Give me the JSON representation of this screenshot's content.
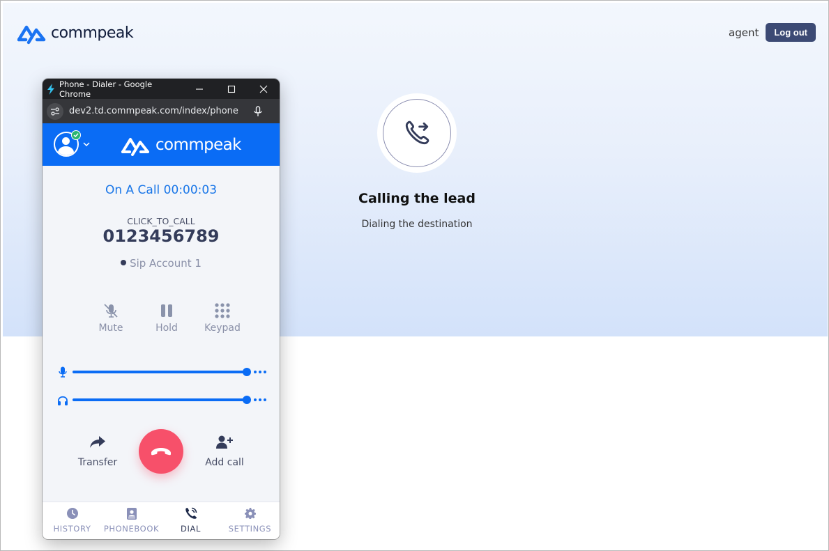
{
  "site": {
    "logo_text": "commpeak",
    "user_name": "agent",
    "logout_label": "Log out"
  },
  "status_panel": {
    "icon": "phone-outgoing-icon",
    "title": "Calling the lead",
    "subtitle": "Dialing the destination"
  },
  "popup_window": {
    "title": "Phone - Dialer - Google Chrome",
    "url": "dev2.td.commpeak.com/index/phone",
    "controls": [
      "minimize",
      "maximize",
      "close"
    ]
  },
  "dialer": {
    "logo_text": "commpeak",
    "presence": "online",
    "call_status": "On A Call 00:00:03",
    "call_type": "CLICK_TO_CALL",
    "number": "0123456789",
    "sip_account": "Sip Account 1",
    "controls": [
      {
        "label": "Mute",
        "icon": "mic-off-icon"
      },
      {
        "label": "Hold",
        "icon": "pause-icon"
      },
      {
        "label": "Keypad",
        "icon": "keypad-icon"
      }
    ],
    "volume": {
      "microphone_percent": 100,
      "speaker_percent": 100
    },
    "actions": {
      "transfer_label": "Transfer",
      "add_call_label": "Add call",
      "hangup": "end-call"
    },
    "nav": [
      {
        "label": "HISTORY",
        "icon": "clock-icon",
        "active": false
      },
      {
        "label": "PHONEBOOK",
        "icon": "contact-book-icon",
        "active": false
      },
      {
        "label": "DIAL",
        "icon": "phone-dial-icon",
        "active": true
      },
      {
        "label": "SETTINGS",
        "icon": "gear-icon",
        "active": false
      }
    ]
  },
  "colors": {
    "brand_blue": "#0a6cf5",
    "hangup_red": "#f7506a",
    "logout_bg": "#3c4a74",
    "text_dark": "#343c5a"
  }
}
